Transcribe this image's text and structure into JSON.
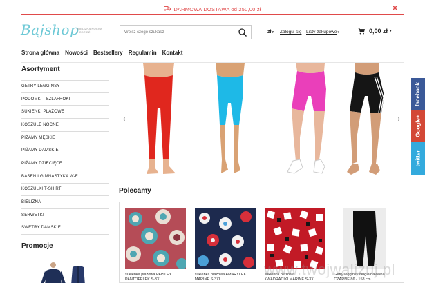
{
  "promo": {
    "text": "DARMOWA DOSTAWA od 250,00 zł",
    "close": "✕"
  },
  "header": {
    "logo": "Bajshop",
    "tagline_1": "BIELIZNA NOCNA",
    "tagline_2": "I ODZIEŻ",
    "search_placeholder": "Wpisz czego szukasz",
    "currency": "zł",
    "login": "Zaloguj się",
    "wishlist": "Listy zakupowe",
    "cart_total": "0,00 zł"
  },
  "nav": [
    "Strona główna",
    "Nowości",
    "Bestsellery",
    "Regulamin",
    "Kontakt"
  ],
  "sidebar": {
    "title": "Asortyment",
    "categories": [
      "GETRY LEGGINSY",
      "PODOMKI I SZLAFROKI",
      "SUKIENKI PLAŻOWE",
      "KOSZULE NOCNE",
      "PIŻAMY MĘSKIE",
      "PIŻAMY DAMSKIE",
      "PIŻAMY DZIECIĘCE",
      "BASEN I GIMNASTYKA W-F",
      "KOSZULKI T-SHIRT",
      "BIELIZNA",
      "SERWETKI",
      "SWETRY DAMSKIE"
    ],
    "promo_title": "Promocje"
  },
  "slider": {
    "prev": "‹",
    "next": "›"
  },
  "recommended": {
    "title": "Polecamy",
    "products": [
      {
        "name_1": "sukienka plażowa PAISLEY",
        "name_2": "PANTOFELEK S-3XL"
      },
      {
        "name_1": "sukienka plażowa AMARYLEK",
        "name_2": "MARINE S-3XL"
      },
      {
        "name_1": "sukienka plażowa",
        "name_2": "KWADRACIKI MARINE S-3XL"
      },
      {
        "name_1": "Getry legginsy długie bawełna",
        "name_2": "CZARNE 86 - 158 cm"
      }
    ]
  },
  "social": [
    "facebook",
    "Google+",
    "twitter"
  ],
  "watermark": "www.twojwalizuj.pl",
  "colors": {
    "accent": "#e04a4a",
    "logo": "#6ec9d6",
    "facebook": "#3b5998",
    "google": "#d34836",
    "twitter": "#33aadd"
  }
}
